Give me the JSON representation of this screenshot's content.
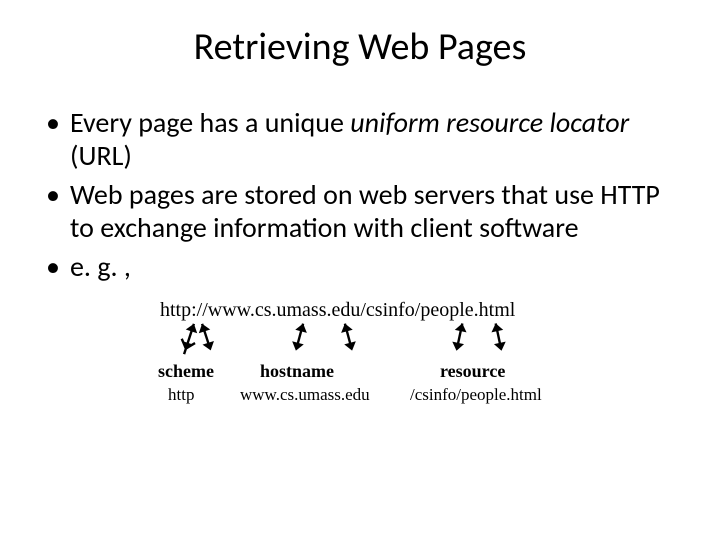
{
  "title": "Retrieving Web Pages",
  "bullets": {
    "b1_pre": "Every page has a unique ",
    "b1_em": "uniform resource locator",
    "b1_post": " (URL)",
    "b2": "Web pages are stored on web servers that use HTTP to exchange information with client software",
    "b3": "e. g. ,"
  },
  "diagram": {
    "url": "http://www.cs.umass.edu/csinfo/people.html",
    "labels": {
      "scheme": "scheme",
      "scheme_value": "http",
      "hostname": "hostname",
      "hostname_value": "www.cs.umass.edu",
      "resource": "resource",
      "resource_value": "/csinfo/people.html"
    }
  }
}
